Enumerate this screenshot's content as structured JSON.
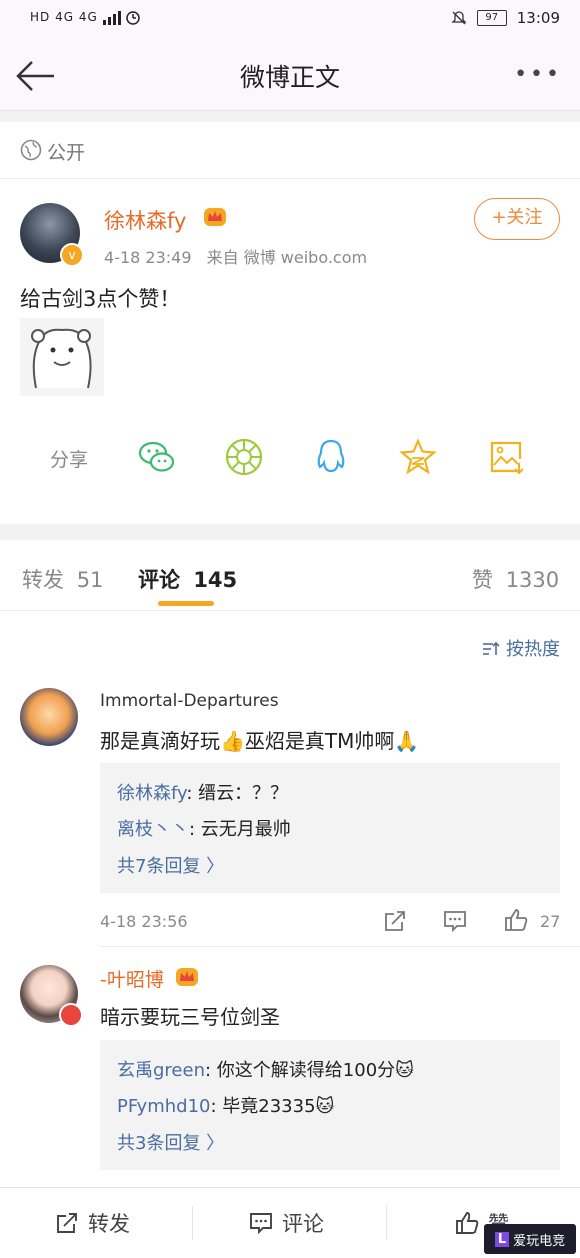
{
  "status_bar": {
    "left_icons": "HD 4G 4G",
    "battery": "97",
    "time": "13:09"
  },
  "header": {
    "title": "微博正文",
    "more": "•••"
  },
  "visibility": {
    "label": "公开"
  },
  "post": {
    "author": "徐林森fy",
    "time": "4-18 23:49",
    "source": "来自 微博 weibo.com",
    "follow_label": "+关注",
    "text": "给古剑3点个赞！"
  },
  "share": {
    "label": "分享",
    "targets": [
      "wechat-icon",
      "moments-icon",
      "qq-icon",
      "qzone-icon",
      "save-image-icon"
    ]
  },
  "tabs": {
    "repost_label": "转发",
    "repost_count": "51",
    "comment_label": "评论",
    "comment_count": "145",
    "like_label": "赞",
    "like_count": "1330"
  },
  "sort": {
    "label": "按热度"
  },
  "comments": [
    {
      "author": "Immortal-Departures",
      "text": "那是真滴好玩👍巫炤是真TM帅啊🙏",
      "replies": [
        {
          "name": "徐林森fy",
          "text": ": 缙云：？？"
        },
        {
          "name": "离枝丶丶",
          "text": ": 云无月最帅"
        }
      ],
      "more_replies": "共7条回复 〉",
      "time": "4-18 23:56",
      "like_count": "27"
    },
    {
      "author": "-叶昭博",
      "text": "暗示要玩三号位剑圣",
      "replies": [
        {
          "name": "玄禹green",
          "text": ": 你这个解读得给100分🐱"
        },
        {
          "name": "PFymhd10",
          "text": ": 毕竟23335🐱"
        }
      ],
      "more_replies": "共3条回复 〉"
    }
  ],
  "bottom_bar": {
    "repost": "转发",
    "comment": "评论",
    "like": "赞"
  },
  "watermark": {
    "text": "爱玩电竞"
  },
  "colors": {
    "accent_orange": "#f08a3c",
    "link_blue": "#4b6ea0",
    "tab_underline": "#f5a623"
  }
}
